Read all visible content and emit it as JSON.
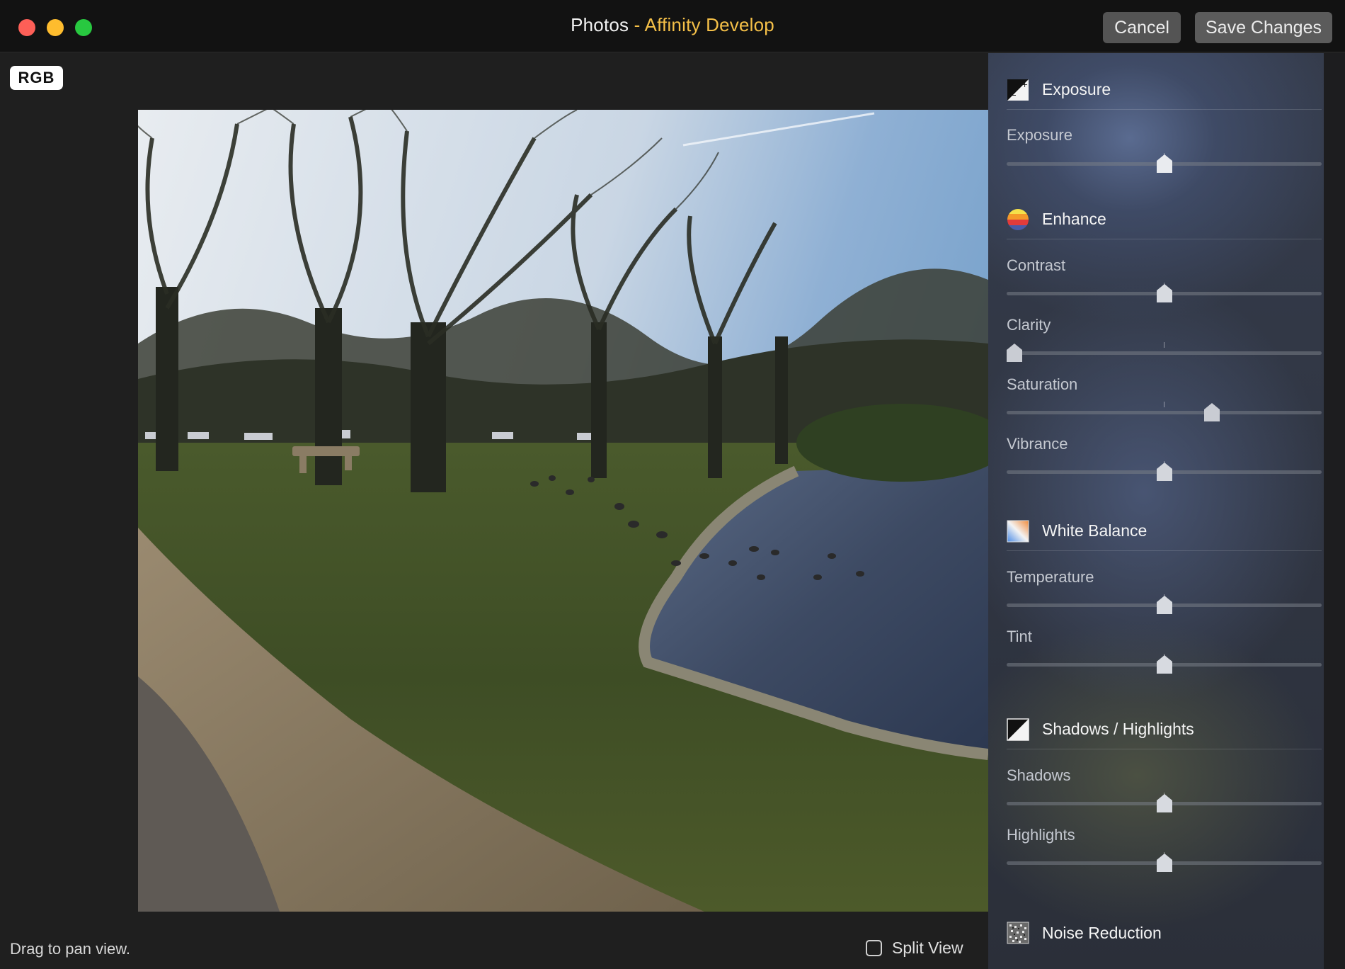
{
  "window": {
    "app_name": "Photos",
    "separator": "-",
    "plugin_name": "Affinity Develop",
    "cancel_label": "Cancel",
    "save_label": "Save Changes"
  },
  "canvas": {
    "channel_badge": "RGB",
    "status_text": "Drag to pan view.",
    "split_view_label": "Split View",
    "split_view_checked": false
  },
  "panel": {
    "sections": [
      {
        "title": "Exposure",
        "icon": "exposure-icon",
        "sliders": [
          {
            "label": "Exposure",
            "value": 0.5
          }
        ]
      },
      {
        "title": "Enhance",
        "icon": "enhance-icon",
        "sliders": [
          {
            "label": "Contrast",
            "value": 0.5
          },
          {
            "label": "Clarity",
            "value": 0.0
          },
          {
            "label": "Saturation",
            "value": 0.66
          },
          {
            "label": "Vibrance",
            "value": 0.5
          }
        ]
      },
      {
        "title": "White Balance",
        "icon": "white-balance-icon",
        "sliders": [
          {
            "label": "Temperature",
            "value": 0.5
          },
          {
            "label": "Tint",
            "value": 0.5
          }
        ]
      },
      {
        "title": "Shadows / Highlights",
        "icon": "shadows-highlights-icon",
        "sliders": [
          {
            "label": "Shadows",
            "value": 0.5
          },
          {
            "label": "Highlights",
            "value": 0.5
          }
        ]
      },
      {
        "title": "Noise Reduction",
        "icon": "noise-reduction-icon",
        "sliders": []
      }
    ]
  },
  "colors": {
    "title_accent": "#f5c048",
    "panel_bg": "#262930",
    "window_bg": "#1f1f1f"
  }
}
